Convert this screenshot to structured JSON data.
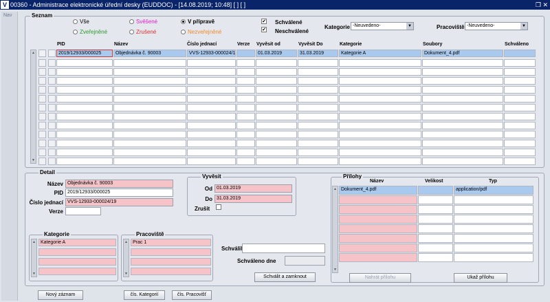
{
  "window": {
    "title": "00360 - Administrace elektronické úřední desky (EUDDOC) - [14.08.2019; 10:48]  [ ]  [ ]",
    "icon_label": "V",
    "restore_icon": "restore-icon",
    "nav_label": "Nav"
  },
  "seznam": {
    "legend": "Seznam",
    "filters": {
      "vse": "Vše",
      "svesene": "Svěšené",
      "v_priprave": "V přípravě",
      "zverejnene": "Zveřejněné",
      "zrusene": "Zrušené",
      "nezverejnene": "Nezveřejněné",
      "selected": "V přípravě",
      "colors": {
        "svesene": "#e020c8",
        "zrusene": "#e03030",
        "nezverejnene": "#f08c28",
        "zverejnene": "#2c9a2c"
      }
    },
    "schvalene_label": "Schválené",
    "schvalene_checked": true,
    "neschvalene_label": "Neschválené",
    "neschvalene_checked": true,
    "kategorie_label": "Kategorie",
    "kategorie_value": "-Neuvedeno-",
    "pracoviste_label": "Pracoviště",
    "pracoviste_value": "-Neuvedeno-"
  },
  "table": {
    "headers": {
      "pid": "PID",
      "nazev": "Název",
      "cislo_jednaci": "Číslo jednací",
      "verze": "Verze",
      "vyvesit_od": "Vyvěsit od",
      "vyvesit_do": "Vyvěsit Do",
      "kategorie": "Kategorie",
      "soubory": "Soubory",
      "schvaleno": "Schváleno"
    },
    "rows": [
      {
        "pid": "2019/12933/000025",
        "nazev": "Objednávka č. 90003",
        "cislo_jednaci": "VVS-12933-000024/1",
        "verze": "",
        "vyvesit_od": "01.03.2019",
        "vyvesit_do": "31.03.2019",
        "kategorie": "Kategorie A",
        "soubory": "Dokument_4.pdf",
        "schvaleno": ""
      }
    ],
    "empty_rows": 12
  },
  "detail": {
    "legend": "Detail",
    "nazev_label": "Název",
    "nazev_value": "Objednávka č. 90003",
    "pid_label": "PID",
    "pid_value": "2019/12933/000025",
    "cj_label": "Číslo jednací",
    "cj_value": "VVS-12933-000024/19",
    "verze_label": "Verze",
    "verze_value": "",
    "vyvesit": {
      "legend": "Vyvěsit",
      "od_label": "Od",
      "od_value": "01.03.2019",
      "do_label": "Do",
      "do_value": "31.03.2019",
      "zrusit_label": "Zrušit",
      "zrusit_checked": false
    },
    "kategorie": {
      "legend": "Kategorie",
      "items": [
        "Kategorie A",
        "",
        "",
        ""
      ]
    },
    "pracoviste": {
      "legend": "Pracoviště",
      "items": [
        "Prac 1",
        "",
        "",
        ""
      ]
    },
    "schvalil_label": "Schválil",
    "schvalil_value": "",
    "schvaleno_dne_label": "Schváleno dne",
    "schvaleno_dne_value": "",
    "schvalit_button": "Schválit a zamknout"
  },
  "prilohy": {
    "legend": "Přílohy",
    "headers": {
      "nazev": "Název",
      "velikost": "Velikost",
      "typ": "Typ"
    },
    "rows": [
      {
        "nazev": "Dokument_4.pdf",
        "velikost": "",
        "typ": "application/pdf"
      },
      {
        "nazev": "",
        "velikost": "",
        "typ": ""
      },
      {
        "nazev": "",
        "velikost": "",
        "typ": ""
      },
      {
        "nazev": "",
        "velikost": "",
        "typ": ""
      },
      {
        "nazev": "",
        "velikost": "",
        "typ": ""
      },
      {
        "nazev": "",
        "velikost": "",
        "typ": ""
      },
      {
        "nazev": "",
        "velikost": "",
        "typ": ""
      },
      {
        "nazev": "",
        "velikost": "",
        "typ": ""
      }
    ],
    "nahrat_button": "Nahrát přílohu",
    "ukaz_button": "Ukaž přílohu"
  },
  "bottom_buttons": {
    "novy": "Nový záznam",
    "cis_kategorii": "čís. Kategorií",
    "cis_pracovist": "čís. Pracovišť"
  }
}
